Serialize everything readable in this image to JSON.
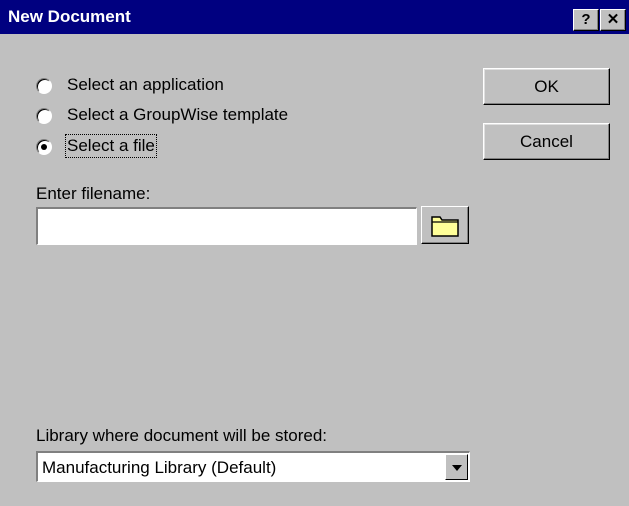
{
  "window": {
    "title": "New Document",
    "help_label": "?",
    "close_label": "✕"
  },
  "options": [
    {
      "label": "Select an application",
      "checked": false
    },
    {
      "label": "Select a GroupWise template",
      "checked": false
    },
    {
      "label": "Select a file",
      "checked": true
    }
  ],
  "buttons": {
    "ok_label": "OK",
    "cancel_label": "Cancel"
  },
  "filename": {
    "label": "Enter filename:",
    "value": ""
  },
  "library": {
    "label": "Library where document will be stored:",
    "selected": "Manufacturing Library  (Default)"
  },
  "icons": {
    "browse": "folder-icon",
    "dropdown": "chevron-down-icon",
    "help": "help-icon",
    "close": "close-icon"
  }
}
